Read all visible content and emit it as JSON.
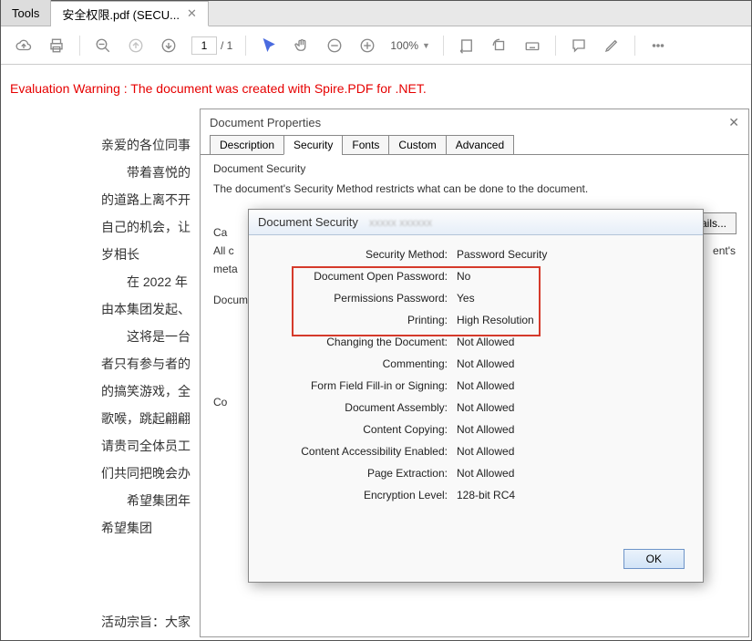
{
  "tabs": [
    {
      "label": "Tools"
    },
    {
      "label": "安全权限.pdf (SECU..."
    }
  ],
  "toolbar": {
    "page_current": "1",
    "page_total": "/  1",
    "zoom": "100%"
  },
  "eval_warning": "Evaluation Warning : The document was created with Spire.PDF for .NET.",
  "document_lines": [
    "亲爱的各位同事",
    "带着喜悦的",
    "的道路上离不开",
    "自己的机会，让",
    "岁相长",
    "在 2022 年",
    "由本集团发起、",
    "这将是一台",
    "者只有参与者的",
    "的搞笑游戏，全",
    "歌喉，跳起翩翩",
    "请贵司全体员工",
    "们共同把晚会办",
    "",
    "希望集团年",
    "希望集团"
  ],
  "bottom_line": "活动宗旨：大家",
  "props_dialog": {
    "title": "Document Properties",
    "tabs": [
      "Description",
      "Security",
      "Fonts",
      "Custom",
      "Advanced"
    ],
    "heading": "Document Security",
    "desc": "The document's Security Method restricts what can be done to the document.",
    "partial1": "Ca",
    "partial2a": "All c",
    "partial2b": "ent's",
    "partial3": "meta",
    "section2": "Docum",
    "partial4": "Co",
    "show_details": "Show Details..."
  },
  "sec_dialog": {
    "title": "Document Security",
    "rows": [
      {
        "k": "Security Method:",
        "v": "Password Security"
      },
      {
        "k": "Document Open Password:",
        "v": "No"
      },
      {
        "k": "Permissions Password:",
        "v": "Yes"
      },
      {
        "k": "Printing:",
        "v": "High Resolution"
      },
      {
        "k": "Changing the Document:",
        "v": "Not Allowed"
      },
      {
        "k": "Commenting:",
        "v": "Not Allowed"
      },
      {
        "k": "Form Field Fill-in or Signing:",
        "v": "Not Allowed"
      },
      {
        "k": "Document Assembly:",
        "v": "Not Allowed"
      },
      {
        "k": "Content Copying:",
        "v": "Not Allowed"
      },
      {
        "k": "Content Accessibility Enabled:",
        "v": "Not Allowed"
      },
      {
        "k": "Page Extraction:",
        "v": "Not Allowed"
      },
      {
        "k": "Encryption Level:",
        "v": "128-bit RC4"
      }
    ],
    "ok": "OK"
  }
}
